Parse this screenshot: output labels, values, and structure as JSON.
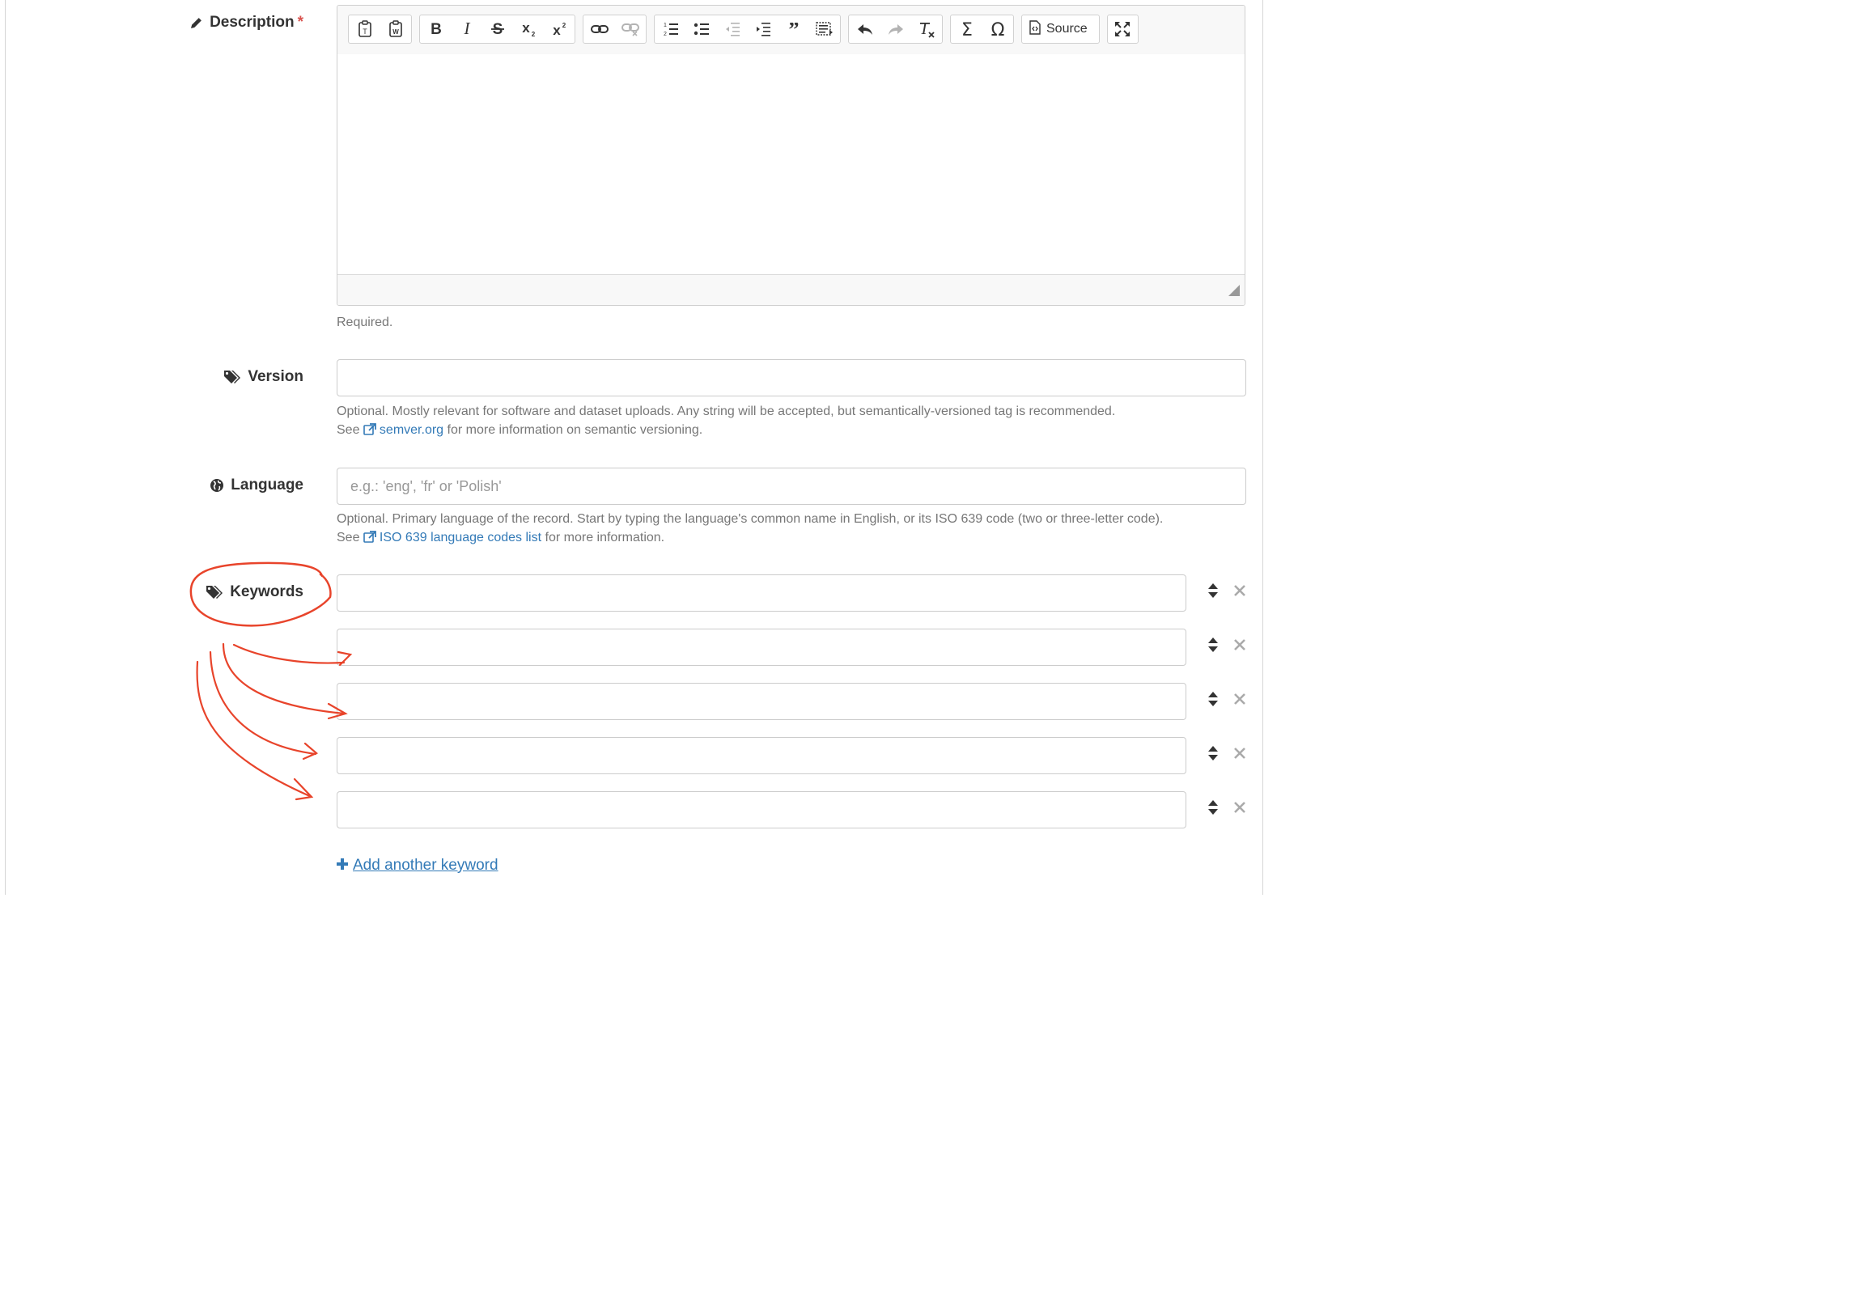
{
  "description": {
    "label": "Description",
    "required_mark": "*",
    "help": "Required.",
    "toolbar": {
      "groups": [
        [
          "paste-text",
          "paste-from-word"
        ],
        [
          "bold",
          "italic",
          "strikethrough",
          "subscript",
          "superscript"
        ],
        [
          "link",
          "unlink"
        ],
        [
          "numbered-list",
          "bulleted-list",
          "outdent",
          "indent",
          "blockquote",
          "show-blocks"
        ],
        [
          "undo",
          "redo",
          "remove-format"
        ],
        [
          "math",
          "special-character"
        ],
        [
          "source"
        ],
        [
          "maximize"
        ]
      ],
      "source_label": "Source"
    },
    "value": ""
  },
  "version": {
    "label": "Version",
    "value": "",
    "help_line1": "Optional. Mostly relevant for software and dataset uploads. Any string will be accepted, but semantically-versioned tag is recommended.",
    "help_see": "See",
    "help_link": "semver.org",
    "help_tail": "for more information on semantic versioning."
  },
  "language": {
    "label": "Language",
    "placeholder": "e.g.: 'eng', 'fr' or 'Polish'",
    "help_line1": "Optional. Primary language of the record. Start by typing the language's common name in English, or its ISO 639 code (two or three-letter code).",
    "help_see": "See",
    "help_link": "ISO 639 language codes list",
    "help_tail": "for more information."
  },
  "keywords": {
    "label": "Keywords",
    "items": [
      "",
      "",
      "",
      "",
      ""
    ],
    "add_label": "Add another keyword"
  },
  "colors": {
    "link": "#337ab7",
    "required": "#d9534f",
    "annotation": "#e8442b",
    "help_text": "#777777",
    "border": "#cccccc"
  }
}
